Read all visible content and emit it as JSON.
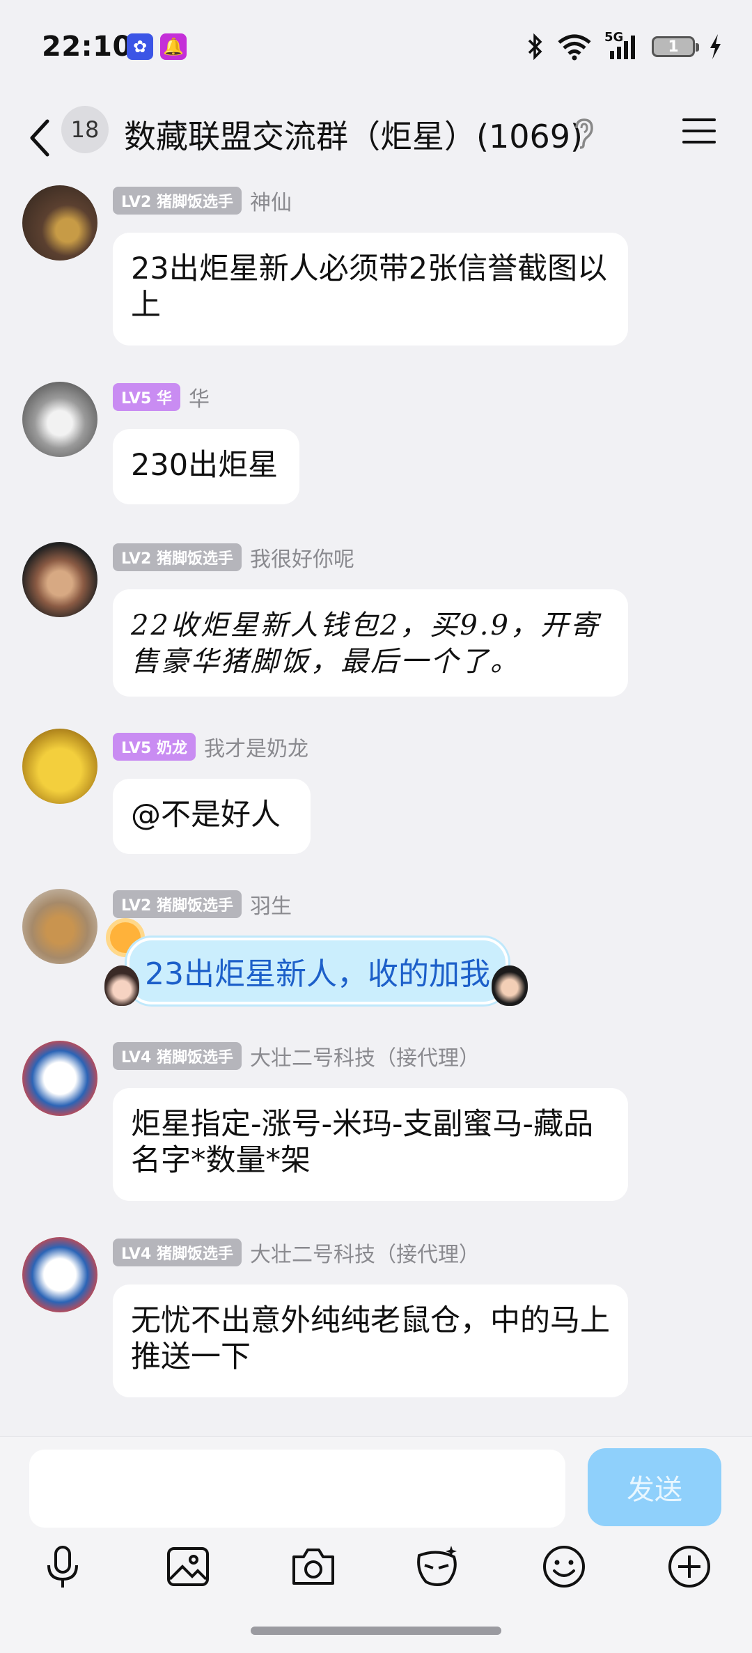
{
  "status": {
    "time": "22:10",
    "network": "5G",
    "battery": "1"
  },
  "header": {
    "unread_count": "18",
    "title": "数藏联盟交流群（炬星）(1069)"
  },
  "messages": [
    {
      "level": "LV2 猪脚饭选手",
      "nick": "神仙",
      "text": "23出炬星新人必须带2张信誉截图以上"
    },
    {
      "level": "LV5 华",
      "nick": "华",
      "text": "230出炬星"
    },
    {
      "level": "LV2 猪脚饭选手",
      "nick": "我很好你呢",
      "text": "22收炬星新人钱包2，买9.9，开寄售豪华猪脚饭，最后一个了。"
    },
    {
      "level": "LV5 奶龙",
      "nick": "我才是奶龙",
      "text": "@不是好人"
    },
    {
      "level": "LV2 猪脚饭选手",
      "nick": "羽生",
      "text": "23出炬星新人，收的加我"
    },
    {
      "level": "LV4 猪脚饭选手",
      "nick": "大壮二号科技（接代理）",
      "text": "炬星指定-涨号-米玛-支副蜜马-藏品名字*数量*架"
    },
    {
      "level": "LV4 猪脚饭选手",
      "nick": "大壮二号科技（接代理）",
      "text": "无忧不出意外纯纯老鼠仓，中的马上推送一下"
    }
  ],
  "input": {
    "placeholder": "",
    "send_label": "发送"
  },
  "toolbar": [
    "microphone-icon",
    "image-icon",
    "camera-icon",
    "sticker-icon",
    "emoji-icon",
    "plus-icon"
  ],
  "colors": {
    "send": "#8fd0fb",
    "level_gray": "#b5b5bb",
    "level_purple": "#c98cf2",
    "link_blue": "#1c5fc9"
  }
}
